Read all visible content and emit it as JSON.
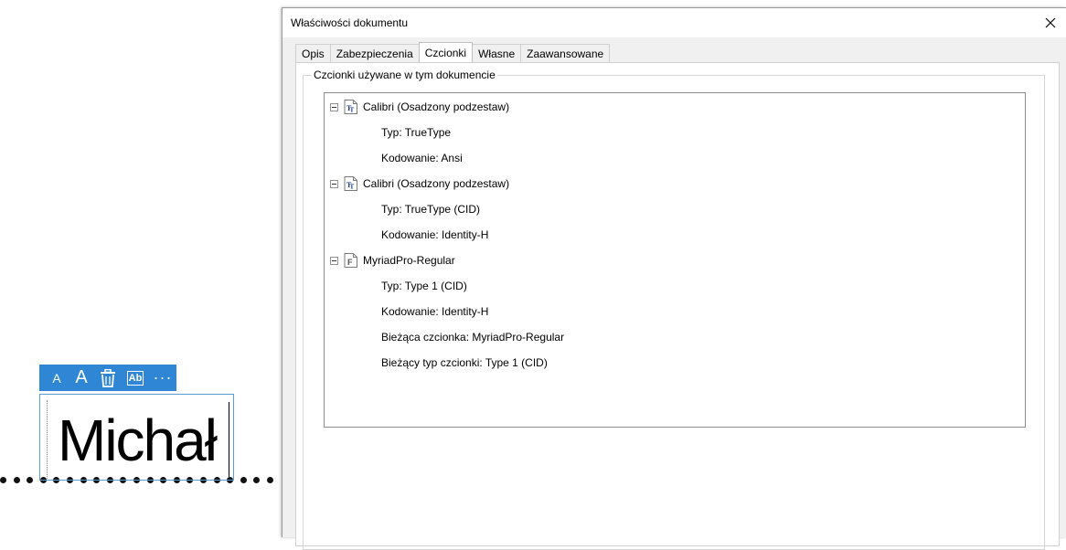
{
  "editor": {
    "field_text": "Michał",
    "mini_toolbar": {
      "small_a": "A",
      "big_a": "A",
      "ab_label": "Ab",
      "more": "···"
    }
  },
  "dialog": {
    "title": "Właściwości dokumentu",
    "tabs": [
      {
        "label": "Opis",
        "active": false
      },
      {
        "label": "Zabezpieczenia",
        "active": false
      },
      {
        "label": "Czcionki",
        "active": true
      },
      {
        "label": "Własne",
        "active": false
      },
      {
        "label": "Zaawansowane",
        "active": false
      }
    ],
    "group_label": "Czcionki używane w tym dokumencie",
    "fonts": [
      {
        "name": "Calibri (Osadzony podzestaw)",
        "icon": "truetype-font-icon",
        "props": [
          "Typ: TrueType",
          "Kodowanie: Ansi"
        ]
      },
      {
        "name": "Calibri (Osadzony podzestaw)",
        "icon": "truetype-font-icon",
        "props": [
          "Typ: TrueType (CID)",
          "Kodowanie: Identity-H"
        ]
      },
      {
        "name": "MyriadPro-Regular",
        "icon": "type1-font-icon",
        "props": [
          "Typ: Type 1 (CID)",
          "Kodowanie: Identity-H",
          "Bieżąca czcionka: MyriadPro-Regular",
          "Bieżący typ czcionki: Type 1 (CID)"
        ]
      }
    ]
  },
  "colors": {
    "accent": "#2f86d4",
    "dialog_bg": "#f0f0f0",
    "truetype_icon": "#1f3c8c"
  }
}
